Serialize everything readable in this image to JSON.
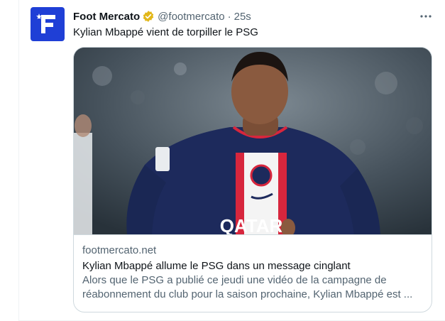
{
  "tweet": {
    "author_name": "Foot Mercato",
    "handle": "@footmercato",
    "separator": "·",
    "time": "25s",
    "text": "Kylian Mbappé vient de torpiller le PSG",
    "verified": true,
    "brand_color": "#1f3fd6",
    "verified_color": "#e2b719"
  },
  "card": {
    "image_icon": "player-photo",
    "jersey_sponsor": "QATAR",
    "domain": "footmercato.net",
    "title": "Kylian Mbappé allume le PSG dans un message cinglant",
    "description_line1": "Alors que le PSG a publié ce jeudi une vidéo de la campagne de",
    "description_line2": "réabonnement du club pour la saison prochaine, Kylian Mbappé est ..."
  }
}
